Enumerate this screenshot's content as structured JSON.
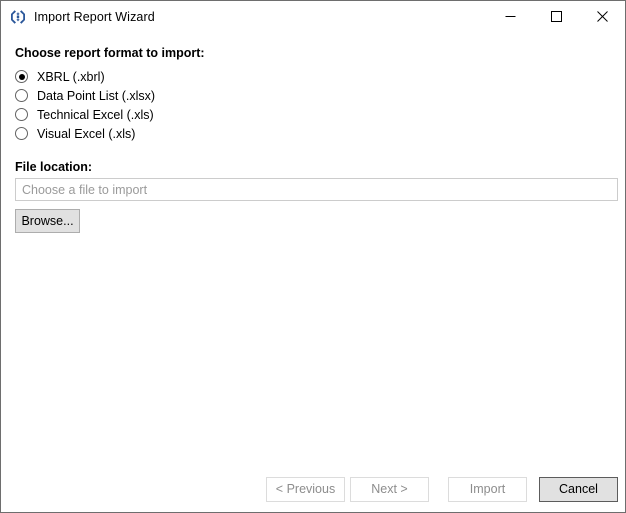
{
  "window": {
    "title": "Import Report Wizard",
    "icon": "app-diamond-icon",
    "controls": {
      "minimize": "minimize-icon",
      "maximize": "maximize-icon",
      "close": "close-icon"
    }
  },
  "format_section": {
    "label": "Choose report format to import:",
    "options": [
      {
        "label": "XBRL (.xbrl)",
        "selected": true
      },
      {
        "label": "Data Point List (.xlsx)",
        "selected": false
      },
      {
        "label": "Technical Excel (.xls)",
        "selected": false
      },
      {
        "label": "Visual Excel (.xls)",
        "selected": false
      }
    ]
  },
  "file_section": {
    "label": "File location:",
    "input_value": "",
    "input_placeholder": "Choose a file to import",
    "browse_label": "Browse..."
  },
  "footer": {
    "previous_label": "< Previous",
    "next_label": "Next >",
    "import_label": "Import",
    "cancel_label": "Cancel"
  },
  "colors": {
    "window_border": "#6e6e6e",
    "accent_icon": "#2b579a",
    "button_face": "#e1e1e1",
    "button_border": "#adadad",
    "disabled_text": "#8d8d8d",
    "placeholder_text": "#9a9a9a",
    "input_border": "#cccccc"
  }
}
